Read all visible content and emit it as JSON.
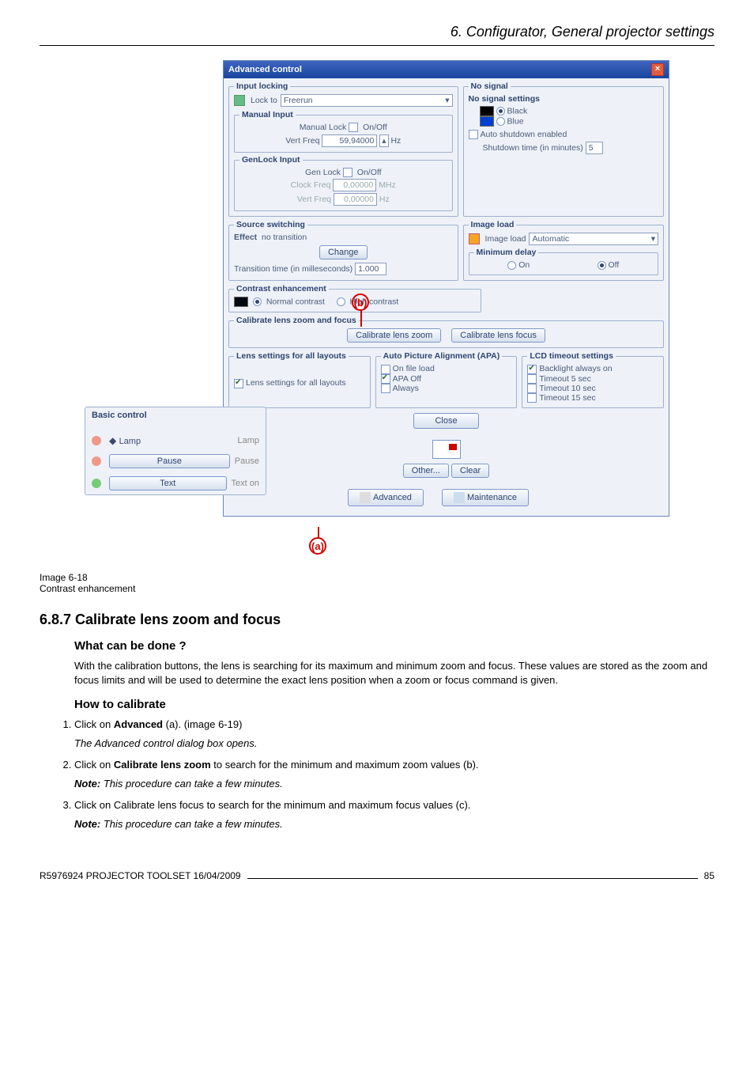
{
  "header": {
    "title": "6. Configurator, General projector settings"
  },
  "window": {
    "title": "Advanced control",
    "input_locking": {
      "legend": "Input locking",
      "lock_to": "Lock to",
      "freerun": "Freerun",
      "manual_input": {
        "legend": "Manual Input",
        "manual_lock": "Manual Lock",
        "onoff": "On/Off",
        "vert_freq": "Vert Freq",
        "vert_freq_val": "59,94000",
        "hz": "Hz"
      },
      "genlock_input": {
        "legend": "GenLock Input",
        "gen_lock": "Gen Lock",
        "onoff": "On/Off",
        "clock_freq": "Clock Freq",
        "clock_val": "0,00000",
        "mhz": "MHz",
        "vert_freq": "Vert Freq",
        "vert_val": "0,00000",
        "hz": "Hz"
      }
    },
    "no_signal": {
      "legend": "No signal",
      "settings": "No signal settings",
      "black": "Black",
      "blue": "Blue",
      "auto_shutdown": "Auto shutdown enabled",
      "shutdown_time": "Shutdown time (in minutes)",
      "shutdown_val": "5"
    },
    "source_switching": {
      "legend": "Source switching",
      "effect": "Effect",
      "no_transition": "no transition",
      "change": "Change",
      "transition_time": "Transition time (in milleseconds)",
      "transition_val": "1.000"
    },
    "image_load": {
      "legend": "Image load",
      "label": "Image load",
      "mode": "Automatic",
      "min_delay": "Minimum delay",
      "on": "On",
      "off": "Off"
    },
    "contrast": {
      "legend": "Contrast enhancement",
      "normal": "Normal contrast",
      "high": "High contrast"
    },
    "calibrate": {
      "legend": "Calibrate lens zoom and focus",
      "zoom": "Calibrate lens zoom",
      "focus": "Calibrate lens focus"
    },
    "lens_layouts": {
      "legend": "Lens settings for all layouts",
      "cb": "Lens settings for all layouts"
    },
    "apa": {
      "legend": "Auto Picture Alignment (APA)",
      "on_file": "On file load",
      "apa_off": "APA Off",
      "always": "Always"
    },
    "lcd": {
      "legend": "LCD timeout settings",
      "backlight": "Backlight always on",
      "t5": "Timeout 5 sec",
      "t10": "Timeout 10 sec",
      "t15": "Timeout 15 sec"
    },
    "close": "Close",
    "other": "Other...",
    "clear": "Clear",
    "tab_advanced": "Advanced",
    "tab_maintenance": "Maintenance"
  },
  "basic": {
    "title": "Basic control",
    "lamp": "Lamp",
    "lamp_hint": "Lamp",
    "pause": "Pause",
    "pause_hint": "Pause",
    "text": "Text",
    "text_hint": "Text on"
  },
  "callouts": {
    "a": "(a)",
    "b": "(b)"
  },
  "caption": {
    "image": "Image 6-18",
    "desc": "Contrast enhancement"
  },
  "section": {
    "num_title": "6.8.7    Calibrate lens zoom and focus",
    "what": "What can be done ?",
    "what_body": "With the calibration buttons, the lens is searching for its maximum and minimum zoom and focus. These values are stored as the zoom and focus limits and will be used to determine the exact lens position when a zoom or focus command is given.",
    "how": "How to calibrate",
    "step1a": "Click on ",
    "step1b": "Advanced",
    "step1c": " (a).  (image 6-19)",
    "step1sub": "The Advanced control dialog box opens.",
    "step2a": "Click on ",
    "step2b": "Calibrate lens zoom",
    "step2c": " to search for the minimum and maximum zoom values (b).",
    "step2note_label": "Note:",
    "step2note": " This procedure can take a few minutes.",
    "step3a": "Click on Calibrate lens focus to search for the minimum and maximum focus values (c).",
    "step3note_label": "Note:",
    "step3note": " This procedure can take a few minutes."
  },
  "footer": {
    "left": "R5976924   PROJECTOR TOOLSET   16/04/2009",
    "page": "85"
  }
}
